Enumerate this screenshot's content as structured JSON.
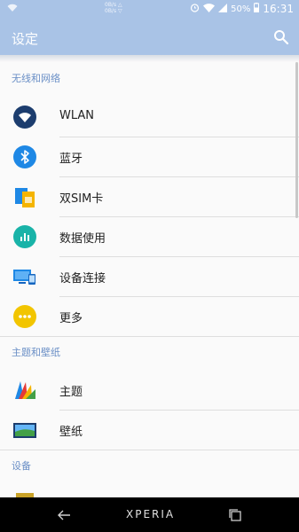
{
  "status_bar": {
    "net_up": "0B/s",
    "net_down": "0B/s",
    "battery": "50%",
    "time": "16:31"
  },
  "app_bar": {
    "title": "设定"
  },
  "sections": [
    {
      "header": "无线和网络",
      "items": [
        {
          "label": "WLAN",
          "icon": "wifi-icon"
        },
        {
          "label": "蓝牙",
          "icon": "bluetooth-icon"
        },
        {
          "label": "双SIM卡",
          "icon": "dual-sim-icon"
        },
        {
          "label": "数据使用",
          "icon": "data-usage-icon"
        },
        {
          "label": "设备连接",
          "icon": "device-connection-icon"
        },
        {
          "label": "更多",
          "icon": "more-icon"
        }
      ]
    },
    {
      "header": "主题和壁纸",
      "items": [
        {
          "label": "主题",
          "icon": "themes-icon"
        },
        {
          "label": "壁纸",
          "icon": "wallpaper-icon"
        }
      ]
    },
    {
      "header": "设备",
      "items": []
    }
  ],
  "nav_bar": {
    "brand": "XPERIA"
  }
}
